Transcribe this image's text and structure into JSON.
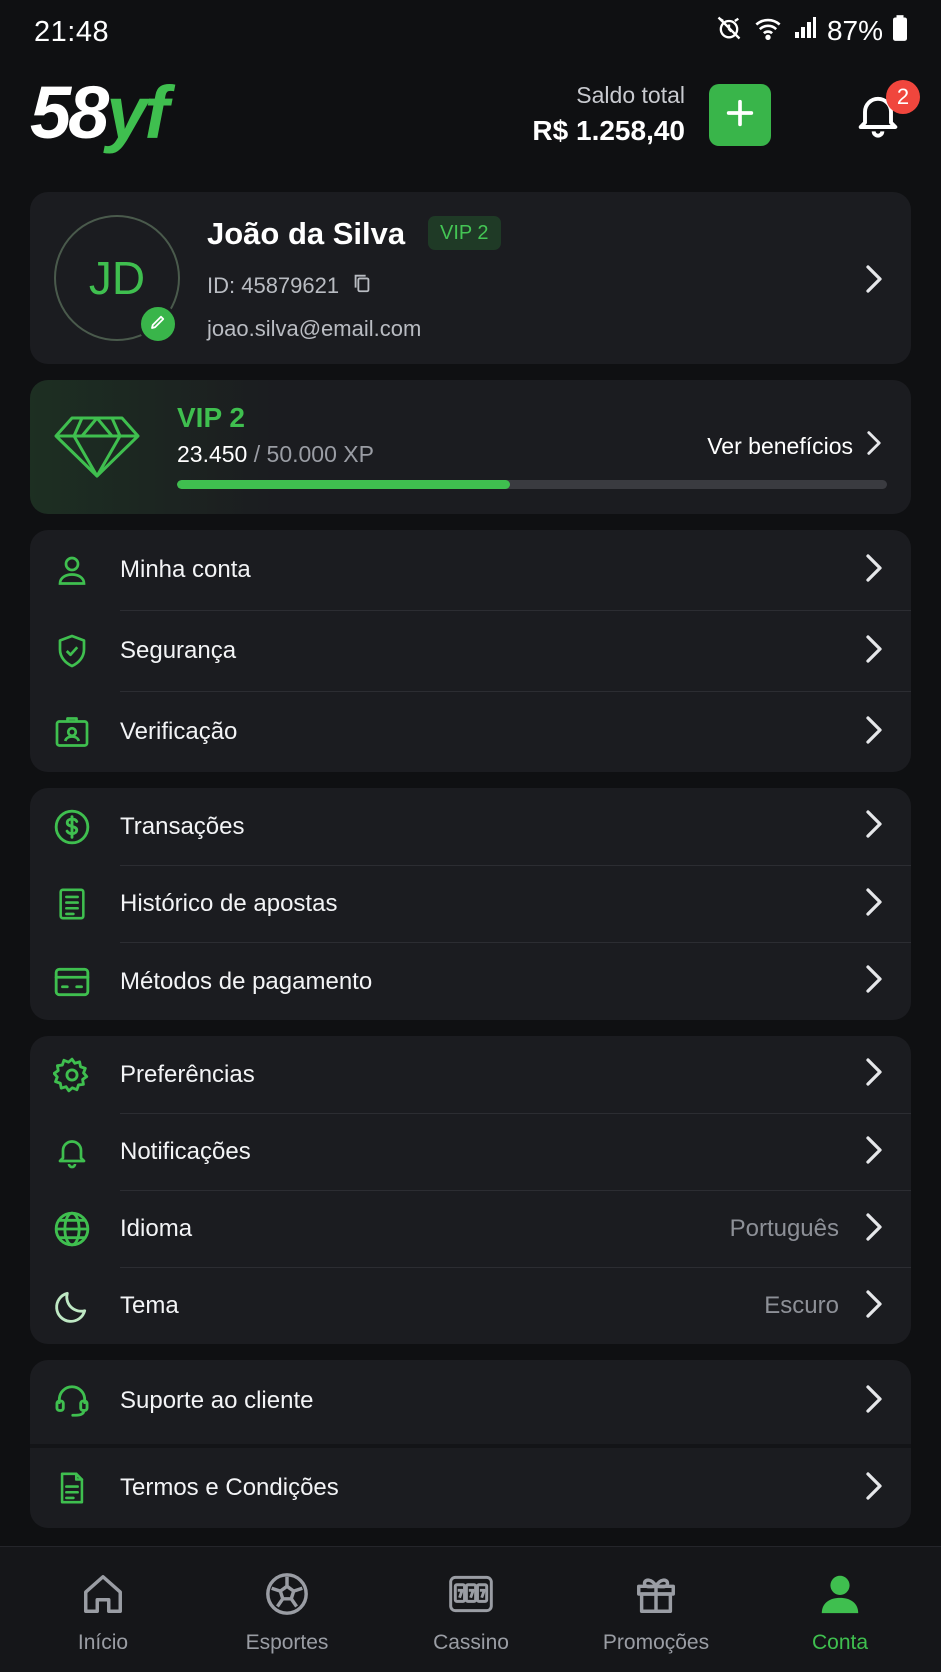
{
  "status_bar": {
    "time": "21:48",
    "battery": "87%"
  },
  "header": {
    "logo_part1": "58",
    "logo_part2": "yf",
    "balance_label": "Saldo total",
    "balance_value": "R$ 1.258,40",
    "notification_count": "2",
    "accent_color": "#3fbf4f"
  },
  "profile": {
    "initials": "JD",
    "name": "João da Silva",
    "vip_badge": "VIP 2",
    "id": "ID: 45879621",
    "email": "joao.silva@email.com"
  },
  "vip": {
    "title": "VIP 2",
    "xp_current": "23.450",
    "xp_total": "/ 50.000 XP",
    "benefits_label": "Ver benefícios",
    "progress_fraction": 0.469
  },
  "menu_account": [
    {
      "label": "Minha conta",
      "icon": "user-icon"
    },
    {
      "label": "Segurança",
      "icon": "shield-icon"
    },
    {
      "label": "Verificação",
      "icon": "id-card-icon"
    }
  ],
  "menu_finance": [
    {
      "label": "Transações",
      "icon": "dollar-icon"
    },
    {
      "label": "Histórico de apostas",
      "icon": "document-list-icon"
    },
    {
      "label": "Métodos de pagamento",
      "icon": "credit-card-icon"
    }
  ],
  "menu_settings": [
    {
      "label": "Preferências",
      "value": "",
      "icon": "gear-icon"
    },
    {
      "label": "Notificações",
      "value": "",
      "icon": "bell-icon"
    },
    {
      "label": "Idioma",
      "value": "Português",
      "icon": "globe-icon"
    },
    {
      "label": "Tema",
      "value": "Escuro",
      "icon": "moon-icon"
    }
  ],
  "menu_support": [
    {
      "label": "Suporte ao cliente",
      "icon": "headset-icon"
    },
    {
      "label": "Termos e Condições",
      "icon": "document-icon"
    }
  ],
  "bottom_nav": [
    {
      "label": "Início",
      "icon": "home-icon"
    },
    {
      "label": "Esportes",
      "icon": "soccer-ball-icon"
    },
    {
      "label": "Cassino",
      "icon": "slot-machine-icon"
    },
    {
      "label": "Promoções",
      "icon": "gift-icon"
    },
    {
      "label": "Conta",
      "icon": "user-filled-icon",
      "active": true
    }
  ]
}
